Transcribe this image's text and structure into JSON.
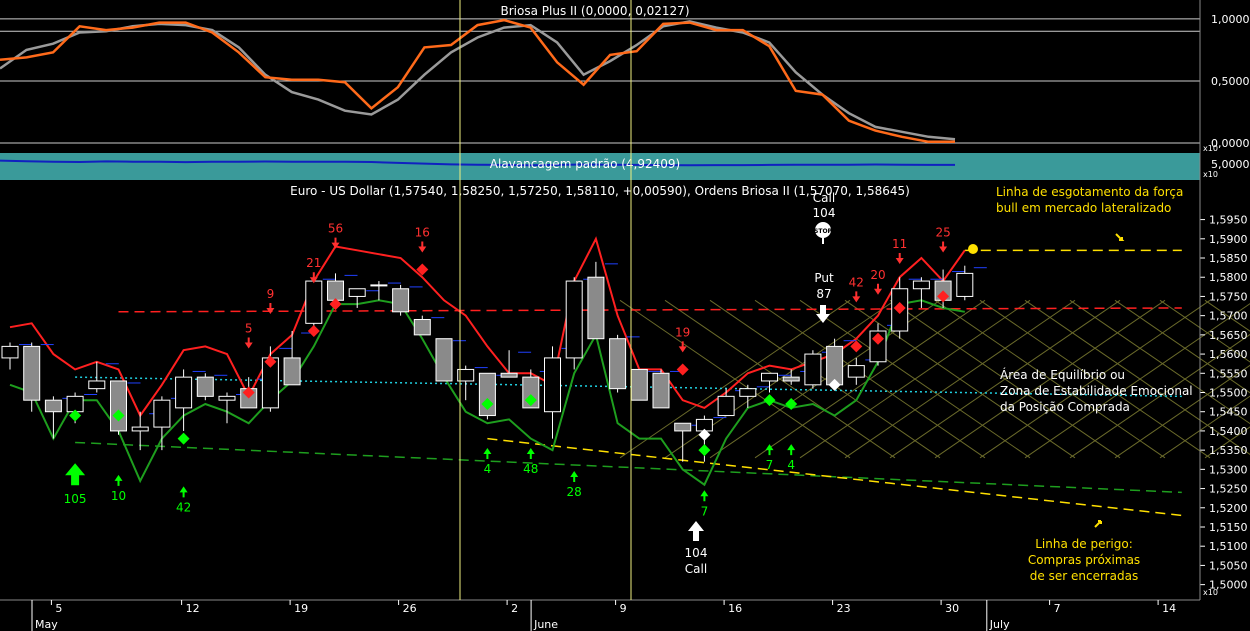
{
  "header": {
    "osc_title": "Briosa Plus II (0,0000, 0,02127)",
    "lev_title": "Alavancagem padrão (4,92409)",
    "main_title": "Euro - US Dollar (1,57540, 1,58250, 1,57250, 1,58110, +0,00590), Ordens Briosa II (1,57070, 1,58645)"
  },
  "scale_tags": {
    "osc": "x10",
    "lev": "x10",
    "main": "x10"
  },
  "colors": {
    "bg": "#000000",
    "osc_fast": "#ff6a1a",
    "osc_slow": "#9a9a9a",
    "lev_fill": "#3a9a9a",
    "lev_line": "#1020c0",
    "red_line": "#ff2020",
    "green_line": "#1e9e1e",
    "bull_text": "#ffe000",
    "white_text": "#ffffff",
    "buy_arrow": "#00ff00",
    "sell_arrow": "#ff2020",
    "grid": "#555555",
    "vline": "#f0f080"
  },
  "chart_data": [
    {
      "type": "line",
      "name": "oscillator",
      "title": "Briosa Plus II (0,0000, 0,02127)",
      "yticks": [
        "1,0000",
        "0,5000",
        "0,0000"
      ],
      "ylim": [
        0,
        1.12
      ],
      "hlines": [
        1.0,
        0.9,
        0.5
      ],
      "series": [
        {
          "name": "fast",
          "values": [
            0.67,
            0.69,
            0.73,
            0.94,
            0.91,
            0.93,
            0.97,
            0.97,
            0.89,
            0.73,
            0.53,
            0.51,
            0.51,
            0.49,
            0.28,
            0.45,
            0.77,
            0.79,
            0.95,
            0.99,
            0.93,
            0.65,
            0.47,
            0.71,
            0.74,
            0.96,
            0.97,
            0.91,
            0.91,
            0.78,
            0.42,
            0.39,
            0.18,
            0.1,
            0.05,
            0.01,
            0.01
          ]
        },
        {
          "name": "slow",
          "values": [
            0.6,
            0.75,
            0.8,
            0.89,
            0.9,
            0.94,
            0.96,
            0.95,
            0.91,
            0.77,
            0.55,
            0.41,
            0.35,
            0.26,
            0.23,
            0.35,
            0.55,
            0.73,
            0.85,
            0.93,
            0.95,
            0.81,
            0.55,
            0.66,
            0.79,
            0.94,
            0.98,
            0.93,
            0.89,
            0.81,
            0.57,
            0.39,
            0.24,
            0.13,
            0.09,
            0.05,
            0.03
          ]
        }
      ]
    },
    {
      "type": "area",
      "name": "alavancagem",
      "title": "Alavancagem padrão (4,92409)",
      "yticks": [
        "5,0000"
      ],
      "values": [
        0.62,
        0.58,
        0.55,
        0.53,
        0.57,
        0.55,
        0.54,
        0.52,
        0.54,
        0.55,
        0.56,
        0.55,
        0.55,
        0.54,
        0.53,
        0.47,
        0.42,
        0.37,
        0.35,
        0.33,
        0.31,
        0.33,
        0.36,
        0.34,
        0.33,
        0.32,
        0.31,
        0.32,
        0.32,
        0.33,
        0.34,
        0.34,
        0.35,
        0.36,
        0.34,
        0.33,
        0.33
      ]
    },
    {
      "type": "candlestick",
      "name": "eurusd",
      "title": "Euro - US Dollar (1,57540, 1,58250, 1,57250, 1,58110, +0,00590), Ordens Briosa II (1,57070, 1,58645)",
      "ylim": [
        1.496,
        1.604
      ],
      "yticks": [
        "1,5950",
        "1,5900",
        "1,5850",
        "1,5800",
        "1,5750",
        "1,5700",
        "1,5650",
        "1,5600",
        "1,5550",
        "1,5500",
        "1,5450",
        "1,5400",
        "1,5350",
        "1,5300",
        "1,5250",
        "1,5200",
        "1,5150",
        "1,5100",
        "1,5050",
        "1,5000"
      ],
      "x_day_ticks": [
        {
          "i": 2,
          "label": "5"
        },
        {
          "i": 8,
          "label": "12"
        },
        {
          "i": 13,
          "label": "19"
        },
        {
          "i": 18,
          "label": "26"
        },
        {
          "i": 23,
          "label": "2"
        },
        {
          "i": 28,
          "label": "9"
        },
        {
          "i": 33,
          "label": "16"
        },
        {
          "i": 38,
          "label": "23"
        },
        {
          "i": 43,
          "label": "30"
        },
        {
          "i": 48,
          "label": "7"
        },
        {
          "i": 53,
          "label": "14"
        }
      ],
      "x_month_labels": [
        {
          "i": 0,
          "label": "May"
        },
        {
          "i": 23,
          "label": "June"
        },
        {
          "i": 44,
          "label": "July"
        }
      ],
      "candles": [
        {
          "o": 1.559,
          "h": 1.563,
          "l": 1.556,
          "c": 1.562
        },
        {
          "o": 1.562,
          "h": 1.563,
          "l": 1.545,
          "c": 1.548
        },
        {
          "o": 1.548,
          "h": 1.549,
          "l": 1.538,
          "c": 1.545
        },
        {
          "o": 1.545,
          "h": 1.55,
          "l": 1.542,
          "c": 1.549
        },
        {
          "o": 1.551,
          "h": 1.558,
          "l": 1.55,
          "c": 1.553
        },
        {
          "o": 1.553,
          "h": 1.553,
          "l": 1.539,
          "c": 1.54
        },
        {
          "o": 1.54,
          "h": 1.545,
          "l": 1.535,
          "c": 1.541
        },
        {
          "o": 1.541,
          "h": 1.549,
          "l": 1.535,
          "c": 1.548
        },
        {
          "o": 1.546,
          "h": 1.556,
          "l": 1.54,
          "c": 1.554
        },
        {
          "o": 1.554,
          "h": 1.555,
          "l": 1.548,
          "c": 1.549
        },
        {
          "o": 1.548,
          "h": 1.55,
          "l": 1.542,
          "c": 1.549
        },
        {
          "o": 1.551,
          "h": 1.554,
          "l": 1.546,
          "c": 1.546
        },
        {
          "o": 1.546,
          "h": 1.562,
          "l": 1.545,
          "c": 1.559
        },
        {
          "o": 1.559,
          "h": 1.566,
          "l": 1.556,
          "c": 1.552
        },
        {
          "o": 1.568,
          "h": 1.58,
          "l": 1.565,
          "c": 1.579
        },
        {
          "o": 1.579,
          "h": 1.581,
          "l": 1.572,
          "c": 1.574
        },
        {
          "o": 1.575,
          "h": 1.577,
          "l": 1.572,
          "c": 1.577
        },
        {
          "o": 1.578,
          "h": 1.579,
          "l": 1.574,
          "c": 1.578
        },
        {
          "o": 1.577,
          "h": 1.578,
          "l": 1.57,
          "c": 1.571
        },
        {
          "o": 1.569,
          "h": 1.57,
          "l": 1.565,
          "c": 1.565
        },
        {
          "o": 1.564,
          "h": 1.564,
          "l": 1.553,
          "c": 1.553
        },
        {
          "o": 1.553,
          "h": 1.557,
          "l": 1.548,
          "c": 1.556
        },
        {
          "o": 1.555,
          "h": 1.555,
          "l": 1.543,
          "c": 1.544
        },
        {
          "o": 1.555,
          "h": 1.561,
          "l": 1.554,
          "c": 1.554
        },
        {
          "o": 1.554,
          "h": 1.556,
          "l": 1.546,
          "c": 1.546
        },
        {
          "o": 1.545,
          "h": 1.562,
          "l": 1.538,
          "c": 1.559
        },
        {
          "o": 1.559,
          "h": 1.58,
          "l": 1.556,
          "c": 1.579
        },
        {
          "o": 1.58,
          "h": 1.584,
          "l": 1.564,
          "c": 1.564
        },
        {
          "o": 1.564,
          "h": 1.565,
          "l": 1.55,
          "c": 1.551
        },
        {
          "o": 1.556,
          "h": 1.556,
          "l": 1.548,
          "c": 1.548
        },
        {
          "o": 1.555,
          "h": 1.556,
          "l": 1.546,
          "c": 1.546
        },
        {
          "o": 1.542,
          "h": 1.542,
          "l": 1.532,
          "c": 1.54
        },
        {
          "o": 1.54,
          "h": 1.544,
          "l": 1.532,
          "c": 1.543
        },
        {
          "o": 1.544,
          "h": 1.551,
          "l": 1.544,
          "c": 1.549
        },
        {
          "o": 1.549,
          "h": 1.552,
          "l": 1.546,
          "c": 1.551
        },
        {
          "o": 1.553,
          "h": 1.555,
          "l": 1.55,
          "c": 1.555
        },
        {
          "o": 1.554,
          "h": 1.556,
          "l": 1.552,
          "c": 1.553
        },
        {
          "o": 1.552,
          "h": 1.561,
          "l": 1.551,
          "c": 1.56
        },
        {
          "o": 1.562,
          "h": 1.564,
          "l": 1.552,
          "c": 1.552
        },
        {
          "o": 1.554,
          "h": 1.559,
          "l": 1.552,
          "c": 1.557
        },
        {
          "o": 1.558,
          "h": 1.568,
          "l": 1.557,
          "c": 1.566
        },
        {
          "o": 1.566,
          "h": 1.58,
          "l": 1.564,
          "c": 1.577
        },
        {
          "o": 1.577,
          "h": 1.58,
          "l": 1.572,
          "c": 1.579
        },
        {
          "o": 1.579,
          "h": 1.582,
          "l": 1.572,
          "c": 1.574
        },
        {
          "o": 1.575,
          "h": 1.583,
          "l": 1.574,
          "c": 1.581
        }
      ],
      "red_line": [
        1.567,
        1.568,
        1.56,
        1.556,
        1.558,
        1.556,
        1.544,
        1.552,
        1.561,
        1.562,
        1.56,
        1.549,
        1.56,
        1.565,
        1.579,
        1.588,
        1.587,
        1.586,
        1.585,
        1.58,
        1.574,
        1.57,
        1.562,
        1.555,
        1.555,
        1.552,
        1.579,
        1.59,
        1.57,
        1.556,
        1.556,
        1.548,
        1.546,
        1.55,
        1.555,
        1.557,
        1.556,
        1.558,
        1.56,
        1.564,
        1.57,
        1.58,
        1.585,
        1.579,
        1.587
      ],
      "green_line": [
        1.552,
        1.55,
        1.538,
        1.548,
        1.548,
        1.54,
        1.527,
        1.538,
        1.544,
        1.547,
        1.545,
        1.542,
        1.548,
        1.553,
        1.562,
        1.573,
        1.573,
        1.574,
        1.573,
        1.564,
        1.554,
        1.545,
        1.542,
        1.543,
        1.538,
        1.535,
        1.555,
        1.565,
        1.542,
        1.538,
        1.538,
        1.53,
        1.526,
        1.538,
        1.546,
        1.548,
        1.546,
        1.547,
        1.544,
        1.548,
        1.558,
        1.573,
        1.574,
        1.572,
        1.571
      ],
      "order_lines": [
        {
          "name": "red-order-line",
          "color": "#ff2020",
          "dash": "10,6",
          "x1": 5,
          "y1": 1.571,
          "x2": 54,
          "y2": 1.572
        },
        {
          "name": "cyan-balance-line",
          "color": "#20d0e0",
          "dash": "2,3",
          "x1": 3,
          "y1": 1.554,
          "x2": 54,
          "y2": 1.549
        },
        {
          "name": "green-support-line",
          "color": "#1e9e1e",
          "dash": "10,6",
          "x1": 3,
          "y1": 1.537,
          "x2": 54,
          "y2": 1.524
        },
        {
          "name": "yellow-danger-line",
          "color": "#ffe000",
          "dash": "10,6",
          "x1": 22,
          "y1": 1.538,
          "x2": 54,
          "y2": 1.518
        },
        {
          "name": "yellow-exhaustion-line",
          "color": "#ffe000",
          "dash": "10,6",
          "x1": 44,
          "y1": 1.587,
          "x2": 54,
          "y2": 1.587
        }
      ],
      "annotations": [
        {
          "label": "105",
          "color": "#00ff00",
          "i": 3,
          "kind": "big-up",
          "y": 1.529
        },
        {
          "label": "10",
          "color": "#00ff00",
          "i": 5,
          "kind": "up",
          "y": 1.527
        },
        {
          "label": "42",
          "color": "#00ff00",
          "i": 8,
          "kind": "up",
          "y": 1.524
        },
        {
          "label": "4",
          "color": "#00ff00",
          "i": 22,
          "kind": "up",
          "y": 1.534
        },
        {
          "label": "48",
          "color": "#00ff00",
          "i": 24,
          "kind": "up",
          "y": 1.534
        },
        {
          "label": "28",
          "color": "#00ff00",
          "i": 26,
          "kind": "up",
          "y": 1.528
        },
        {
          "label": "7",
          "color": "#00ff00",
          "i": 32,
          "kind": "up",
          "y": 1.523
        },
        {
          "label": "7",
          "color": "#00ff00",
          "i": 35,
          "kind": "up",
          "y": 1.535
        },
        {
          "label": "4",
          "color": "#00ff00",
          "i": 36,
          "kind": "up",
          "y": 1.535
        },
        {
          "label": "5",
          "color": "#ff3030",
          "i": 11,
          "kind": "down",
          "y": 1.563
        },
        {
          "label": "9",
          "color": "#ff3030",
          "i": 12,
          "kind": "down",
          "y": 1.572
        },
        {
          "label": "21",
          "color": "#ff3030",
          "i": 14,
          "kind": "down",
          "y": 1.58
        },
        {
          "label": "56",
          "color": "#ff3030",
          "i": 15,
          "kind": "down",
          "y": 1.589
        },
        {
          "label": "16",
          "color": "#ff3030",
          "i": 19,
          "kind": "down",
          "y": 1.588
        },
        {
          "label": "19",
          "color": "#ff3030",
          "i": 31,
          "kind": "down",
          "y": 1.562
        },
        {
          "label": "42",
          "color": "#ff3030",
          "i": 39,
          "kind": "down",
          "y": 1.575
        },
        {
          "label": "20",
          "color": "#ff3030",
          "i": 40,
          "kind": "down",
          "y": 1.577
        },
        {
          "label": "11",
          "color": "#ff3030",
          "i": 41,
          "kind": "down",
          "y": 1.585
        },
        {
          "label": "25",
          "color": "#ff3030",
          "i": 43,
          "kind": "down",
          "y": 1.588
        }
      ],
      "diamonds": [
        {
          "i": 3,
          "y": 1.544,
          "color": "#00ff00"
        },
        {
          "i": 5,
          "y": 1.544,
          "color": "#00ff00"
        },
        {
          "i": 8,
          "y": 1.538,
          "color": "#00ff00"
        },
        {
          "i": 22,
          "y": 1.547,
          "color": "#00ff00"
        },
        {
          "i": 24,
          "y": 1.548,
          "color": "#00ff00"
        },
        {
          "i": 32,
          "y": 1.535,
          "color": "#00ff00"
        },
        {
          "i": 35,
          "y": 1.548,
          "color": "#00ff00"
        },
        {
          "i": 36,
          "y": 1.547,
          "color": "#00ff00"
        },
        {
          "i": 11,
          "y": 1.55,
          "color": "#ff2020"
        },
        {
          "i": 12,
          "y": 1.558,
          "color": "#ff2020"
        },
        {
          "i": 14,
          "y": 1.566,
          "color": "#ff2020"
        },
        {
          "i": 15,
          "y": 1.573,
          "color": "#ff2020"
        },
        {
          "i": 19,
          "y": 1.582,
          "color": "#ff2020"
        },
        {
          "i": 31,
          "y": 1.556,
          "color": "#ff2020"
        },
        {
          "i": 39,
          "y": 1.562,
          "color": "#ff2020"
        },
        {
          "i": 40,
          "y": 1.564,
          "color": "#ff2020"
        },
        {
          "i": 41,
          "y": 1.572,
          "color": "#ff2020"
        },
        {
          "i": 43,
          "y": 1.575,
          "color": "#ff2020"
        },
        {
          "i": 32,
          "y": 1.539,
          "color": "#ffffff"
        },
        {
          "i": 38,
          "y": 1.552,
          "color": "#ffffff"
        }
      ],
      "markers": {
        "call_stop": {
          "label_top": "Call",
          "value": "104",
          "icon": "STOP"
        },
        "put": {
          "label": "Put",
          "value": "87"
        },
        "call_bottom": {
          "value": "104",
          "label": "Call"
        }
      },
      "notes": {
        "exhaustion": [
          "Linha de esgotamento da força",
          "bull em mercado lateralizado"
        ],
        "balance": [
          "Área de Equilíbrio ou",
          "Zona de Estabilidade Emocional",
          "da Posição Comprada"
        ],
        "danger": [
          "Linha de perigo:",
          "Compras próximas",
          "de ser encerradas"
        ]
      }
    }
  ]
}
